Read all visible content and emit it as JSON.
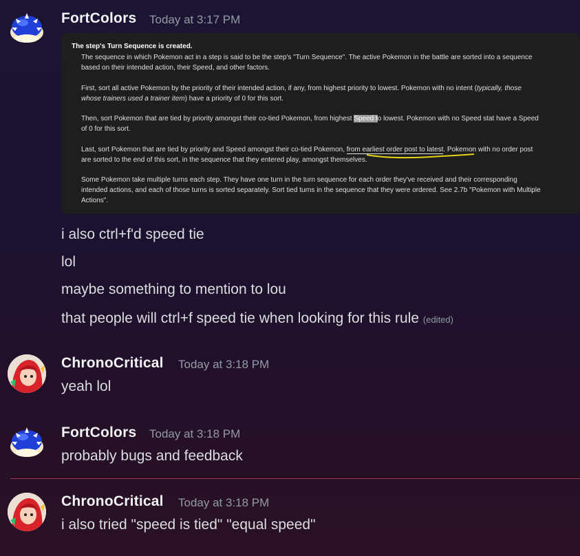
{
  "messages": [
    {
      "username": "FortColors",
      "timestamp": "Today at 3:17 PM",
      "avatar_icon": "blue-shell-icon",
      "screenshot": {
        "heading": "The step's Turn Sequence is created.",
        "p1a": "The sequence in which Pokemon act in a step is said to be the step's \"Turn Sequence\". The active Pokemon in the battle are sorted into a sequence",
        "p1b": "based on their intended action, their Speed, and other factors.",
        "p2a_pre": "First, sort all active Pokemon by the priority of their intended action, if any, from highest priority to lowest. Pokemon with no intent (",
        "p2a_it": "typically, those",
        "p2b_it": "whose trainers used a trainer item",
        "p2b_post": ") have a priority of 0 for this sort.",
        "p3a_pre": "Then, sort Pokemon that are tied by priority amongst their co-tied Pokemon, from highest ",
        "p3a_hl": "Speed t",
        "p3a_post": "o lowest. Pokemon with no Speed stat have a Speed",
        "p3b": "of 0 for this sort.",
        "p4a_pre": "Last, sort Pokemon that are tied by priority and Speed amongst their co-tied Pokemon, ",
        "p4a_ul": "from earliest order post to latest",
        "p4a_post": ". Pokemon with no order post",
        "p4b": "are sorted to the end of this sort, in the sequence that they entered play, amongst themselves.",
        "p5a": "Some Pokemon take multiple turns each step. They have one turn in the turn sequence for each order they've received and their corresponding",
        "p5b": "intended actions, and each of those turns is sorted separately. Sort tied turns in the sequence that they were ordered. See 2.7b \"Pokemon with Multiple",
        "p5c": "Actions\"."
      },
      "lines": [
        "i also ctrl+f'd speed tie",
        "lol",
        "maybe something to mention to lou",
        "that people will ctrl+f speed tie when looking for this rule"
      ],
      "edited": "(edited)"
    },
    {
      "username": "ChronoCritical",
      "timestamp": "Today at 3:18 PM",
      "avatar_icon": "red-haired-character-avatar",
      "lines": [
        "yeah lol"
      ]
    },
    {
      "username": "FortColors",
      "timestamp": "Today at 3:18 PM",
      "avatar_icon": "blue-shell-icon",
      "lines": [
        "probably bugs and feedback"
      ]
    },
    {
      "username": "ChronoCritical",
      "timestamp": "Today at 3:18 PM",
      "avatar_icon": "red-haired-character-avatar",
      "lines": [
        "i also tried \"speed is tied\" \"equal speed\""
      ]
    }
  ],
  "colors": {
    "username": "#f2f3f5",
    "timestamp": "#949ba4",
    "text": "#dbdee1",
    "new_messages_divider": "#a23a4a",
    "annotation_yellow": "#e8d21a"
  }
}
